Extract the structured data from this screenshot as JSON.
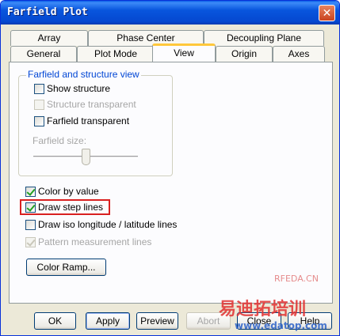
{
  "window": {
    "title": "Farfield Plot"
  },
  "tabs_back": [
    "Array",
    "Phase Center",
    "Decoupling Plane"
  ],
  "tabs_front": [
    "General",
    "Plot Mode",
    "View",
    "Origin",
    "Axes"
  ],
  "group": {
    "title": "Farfield and structure view",
    "show_structure": "Show structure",
    "structure_transparent": "Structure transparent",
    "farfield_transparent": "Farfield transparent",
    "farfield_size_label": "Farfield size:",
    "farfield_size_level": 0.5
  },
  "options": {
    "color_by_value": "Color by value",
    "draw_step_lines": "Draw step lines",
    "draw_iso_lines": "Draw iso longitude / latitude lines",
    "pattern_measurement": "Pattern measurement lines"
  },
  "color_ramp_button": "Color Ramp...",
  "buttons": {
    "ok": "OK",
    "apply": "Apply",
    "preview": "Preview",
    "abort": "Abort",
    "close": "Close",
    "help": "Help"
  },
  "watermark": {
    "line1": "RFEDA.CN",
    "line2": "易迪拓培训",
    "line3": "www.edatop.com"
  }
}
